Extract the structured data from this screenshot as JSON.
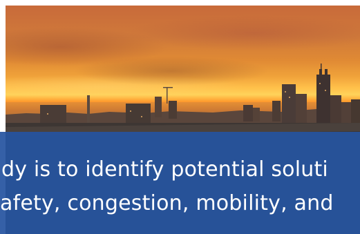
{
  "hero": {
    "image": "sunset-city-skyline",
    "colors": {
      "sky_top": "#c86a3a",
      "sun_glow": "#ffd35a",
      "city": "#3a3432"
    }
  },
  "caption": {
    "line1": "dy is to identify potential soluti",
    "line2": "afety, congestion, mobility, and",
    "background_color": "#2654a0",
    "text_color": "#ffffff"
  }
}
